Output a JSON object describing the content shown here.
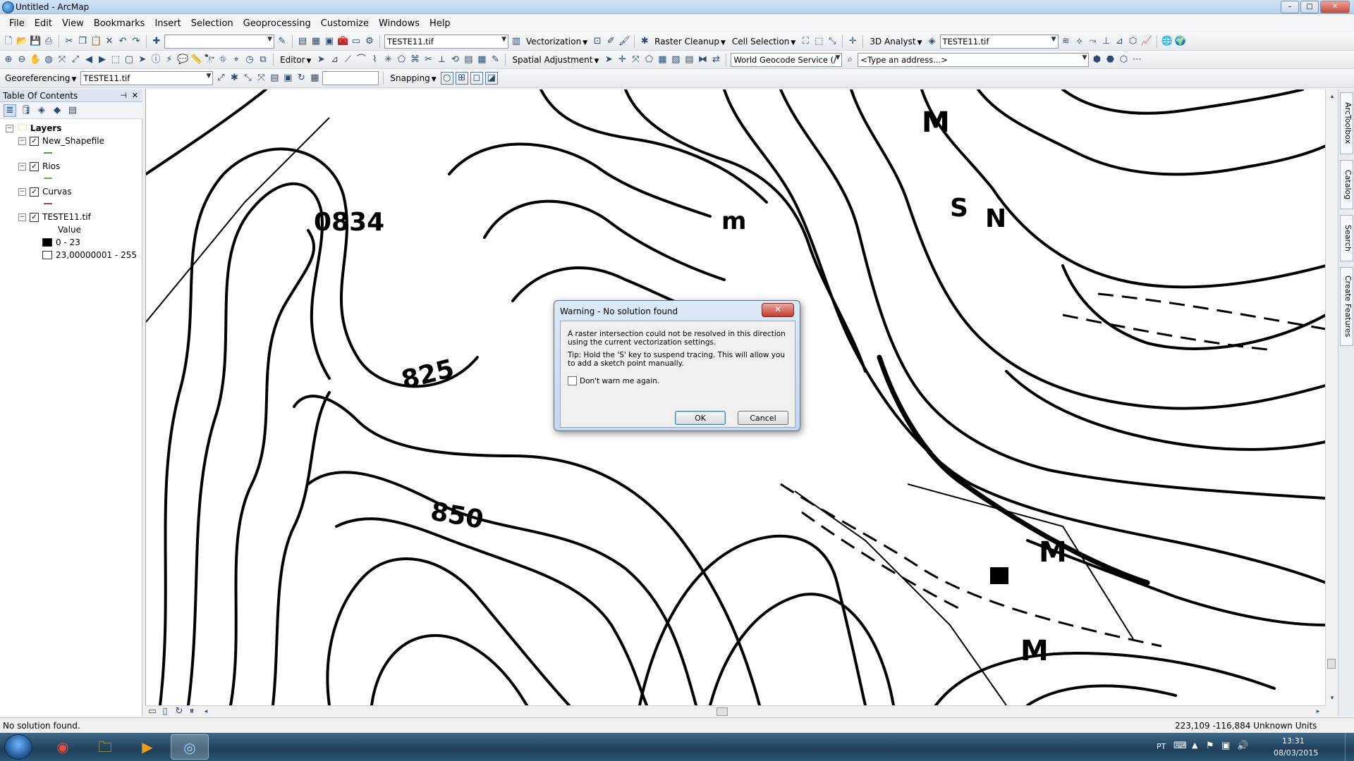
{
  "window": {
    "title": "Untitled - ArcMap",
    "min": "–",
    "max": "□",
    "close": "✕"
  },
  "menu": [
    "File",
    "Edit",
    "View",
    "Bookmarks",
    "Insert",
    "Selection",
    "Geoprocessing",
    "Customize",
    "Windows",
    "Help"
  ],
  "toolbar1": {
    "scale_value": "",
    "raster_layer": "TESTE11.tif",
    "vectorization": "Vectorization",
    "raster_cleanup": "Raster Cleanup",
    "cell_selection": "Cell Selection",
    "analyst": "3D Analyst",
    "analyst_layer": "TESTE11.tif"
  },
  "toolbar2": {
    "editor": "Editor",
    "spatial_adjustment": "Spatial Adjustment",
    "geocode_service": "World Geocode Service (/",
    "address_placeholder": "<Type an address...>"
  },
  "toolbar3": {
    "georeferencing": "Georeferencing",
    "georef_layer": "TESTE11.tif",
    "snapping": "Snapping"
  },
  "toc": {
    "title": "Table Of Contents",
    "pin": "⊣",
    "close": "✕",
    "root": "Layers",
    "layers": [
      {
        "name": "New_Shapefile",
        "symbol_color": "#4aa04a"
      },
      {
        "name": "Rios",
        "symbol_color": "#6ab04c"
      },
      {
        "name": "Curvas",
        "symbol_color": "#a04a4a"
      },
      {
        "name": "TESTE11.tif"
      }
    ],
    "raster_field": "Value",
    "classes": [
      {
        "label": "0 - 23",
        "color": "#000000"
      },
      {
        "label": "23,00000001 - 255",
        "color": "#ffffff"
      }
    ]
  },
  "map_labels": {
    "l0834": "0834",
    "l825": "825",
    "l850": "850",
    "lm1": "M",
    "lm2": "M",
    "lm3": "M",
    "lm4": "M",
    "lm5": "m",
    "ls": "S",
    "ln": "N"
  },
  "dialog": {
    "title": "Warning - No solution found",
    "message": "A raster intersection could not be resolved in this direction using the current vectorization settings.",
    "tip": "Tip:  Hold the 'S' key to suspend tracing.  This will allow you to add a sketch point manually.",
    "checkbox_label": "Don't warn me again.",
    "ok": "OK",
    "cancel": "Cancel",
    "close": "✕"
  },
  "right_dock": [
    "ArcToolbox",
    "Catalog",
    "Search",
    "Create Features"
  ],
  "status": {
    "message": "No solution found.",
    "coordinates": "223,109  -116,884 Unknown Units"
  },
  "taskbar": {
    "language": "PT",
    "time": "13:31",
    "date": "08/03/2015"
  }
}
